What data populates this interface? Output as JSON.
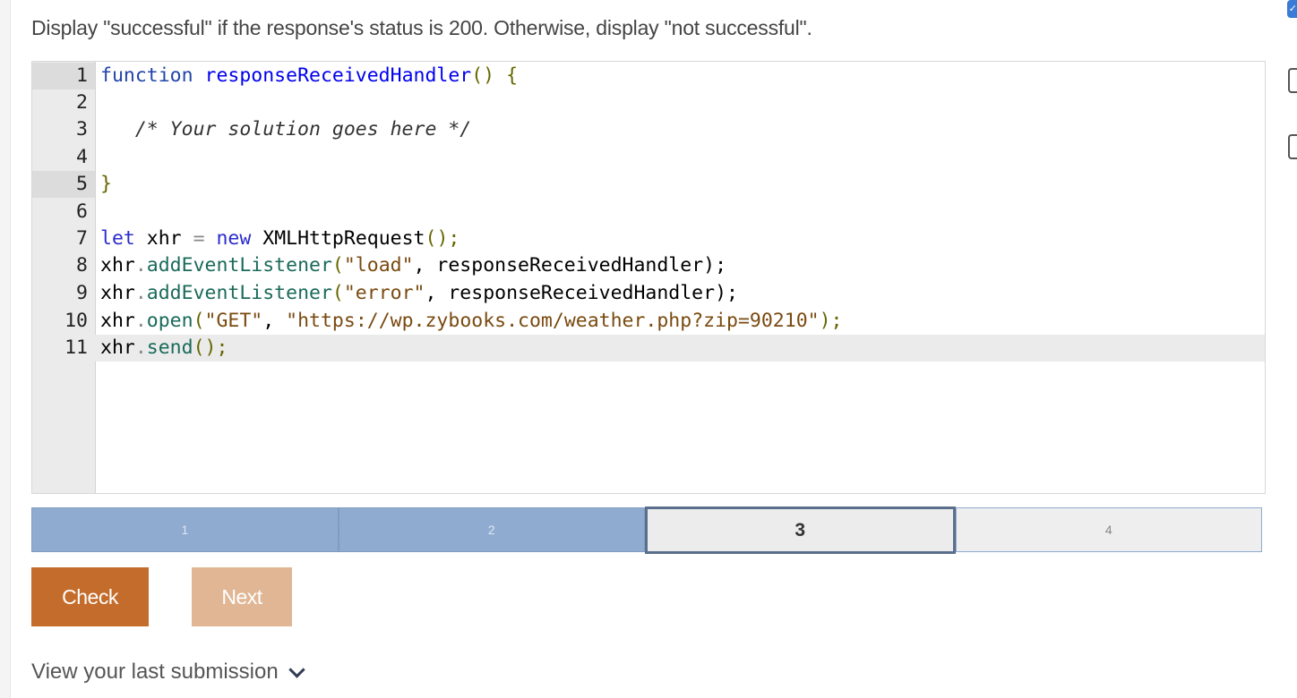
{
  "instructions": "Display \"successful\" if the response's status is 200. Otherwise, display \"not successful\".",
  "editor": {
    "lines": [
      {
        "n": "1"
      },
      {
        "n": "2"
      },
      {
        "n": "3"
      },
      {
        "n": "4"
      },
      {
        "n": "5"
      },
      {
        "n": "6"
      },
      {
        "n": "7"
      },
      {
        "n": "8"
      },
      {
        "n": "9"
      },
      {
        "n": "10"
      },
      {
        "n": "11"
      }
    ],
    "tokens": {
      "l1_kw": "function",
      "l1_fn": "responseReceivedHandler",
      "l1_rest": "() {",
      "l3_comment": "/* Your solution goes here */",
      "l5_close": "}",
      "l7_let": "let",
      "l7_var": " xhr ",
      "l7_eq": "=",
      "l7_new": "new",
      "l7_ctor": " XMLHttpRequest",
      "l7_end": "();",
      "l8_obj": "xhr",
      "l8_dot": ".",
      "l8_method": "addEventListener",
      "l8_open": "(",
      "l8_str": "\"load\"",
      "l8_rest": ", responseReceivedHandler);",
      "l9_obj": "xhr",
      "l9_dot": ".",
      "l9_method": "addEventListener",
      "l9_open": "(",
      "l9_str": "\"error\"",
      "l9_rest": ", responseReceivedHandler);",
      "l10_obj": "xhr",
      "l10_dot": ".",
      "l10_method": "open",
      "l10_open": "(",
      "l10_str1": "\"GET\"",
      "l10_comma": ", ",
      "l10_str2": "\"https://wp.zybooks.com/weather.php?zip=90210\"",
      "l10_end": ");",
      "l11_obj": "xhr",
      "l11_dot": ".",
      "l11_method": "send",
      "l11_end": "();"
    }
  },
  "progress": {
    "steps": [
      {
        "label": "1",
        "state": "done"
      },
      {
        "label": "2",
        "state": "done"
      },
      {
        "label": "3",
        "state": "current"
      },
      {
        "label": "4",
        "state": "todo"
      }
    ]
  },
  "buttons": {
    "check_label": "Check",
    "next_label": "Next"
  },
  "last_submission": {
    "label": "View your last submission",
    "icon": "chevron-down-icon"
  },
  "colors": {
    "check_button": "#c46c2b",
    "next_button_disabled": "#e1b694",
    "progress_done": "#8fabd0",
    "progress_current_border": "#5b6f8c"
  }
}
